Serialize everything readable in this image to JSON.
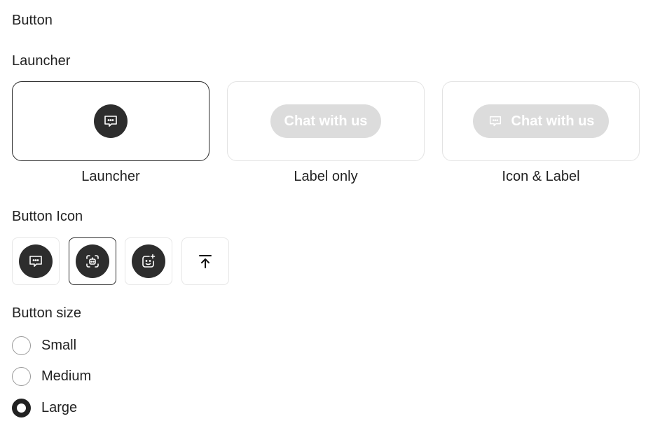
{
  "sections": {
    "button": "Button",
    "launcher": "Launcher",
    "button_icon": "Button Icon",
    "button_size": "Button size"
  },
  "launcher_styles": [
    {
      "caption": "Launcher",
      "selected": true
    },
    {
      "caption": "Label only",
      "button_text": "Chat with us",
      "selected": false
    },
    {
      "caption": "Icon & Label",
      "button_text": "Chat with us",
      "selected": false
    }
  ],
  "button_icons": [
    {
      "icon": "chat-bubble-icon",
      "selected": false
    },
    {
      "icon": "robot-face-icon",
      "selected": true
    },
    {
      "icon": "sparkle-face-icon",
      "selected": false
    },
    {
      "icon": "arrow-up-to-line-icon",
      "selected": false
    }
  ],
  "sizes": [
    {
      "label": "Small",
      "checked": false
    },
    {
      "label": "Medium",
      "checked": false
    },
    {
      "label": "Large",
      "checked": true
    }
  ],
  "colors": {
    "dark": "#2d2d2d",
    "pill_bg": "#dcdcdc",
    "border": "#e3e3e3",
    "selected_border": "#2b2b2b"
  }
}
